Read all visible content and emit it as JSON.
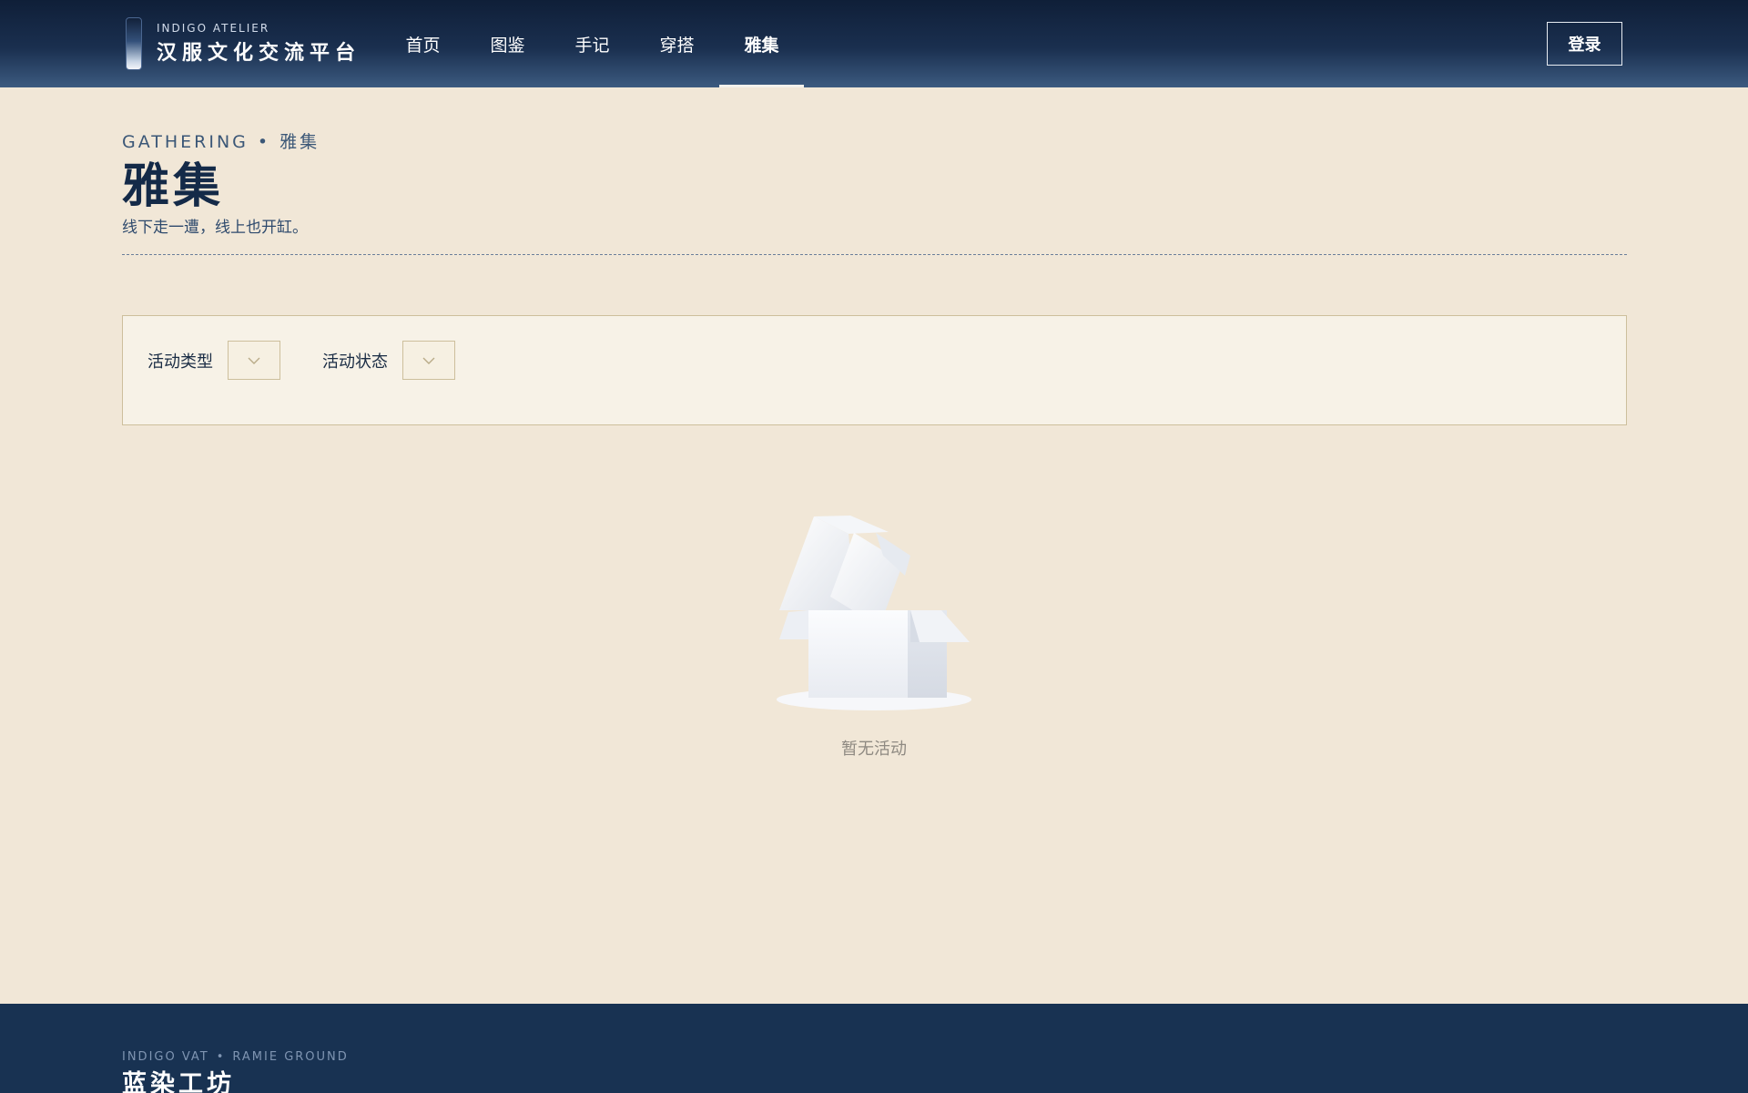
{
  "header": {
    "brand_en": "INDIGO ATELIER",
    "brand_zh": "汉服文化交流平台",
    "nav": [
      {
        "label": "首页",
        "active": false
      },
      {
        "label": "图鉴",
        "active": false
      },
      {
        "label": "手记",
        "active": false
      },
      {
        "label": "穿搭",
        "active": false
      },
      {
        "label": "雅集",
        "active": true
      }
    ],
    "login_label": "登录"
  },
  "page": {
    "eyebrow_en": "GATHERING",
    "eyebrow_sep": "•",
    "eyebrow_zh": "雅集",
    "title": "雅集",
    "subtitle": "线下走一遭，线上也开缸。"
  },
  "filters": {
    "type_label": "活动类型",
    "type_value": "",
    "status_label": "活动状态",
    "status_value": ""
  },
  "empty": {
    "text": "暂无活动",
    "icon": "empty-box-icon"
  },
  "footer": {
    "en_left": "INDIGO VAT",
    "en_sep": "•",
    "en_right": "RAMIE GROUND",
    "zh": "蓝染工坊"
  },
  "colors": {
    "header_dark": "#0f1f38",
    "page_bg": "#f1e7d7",
    "title": "#142a48",
    "panel_border": "#cdbf9c",
    "footer_bg": "#183252"
  }
}
